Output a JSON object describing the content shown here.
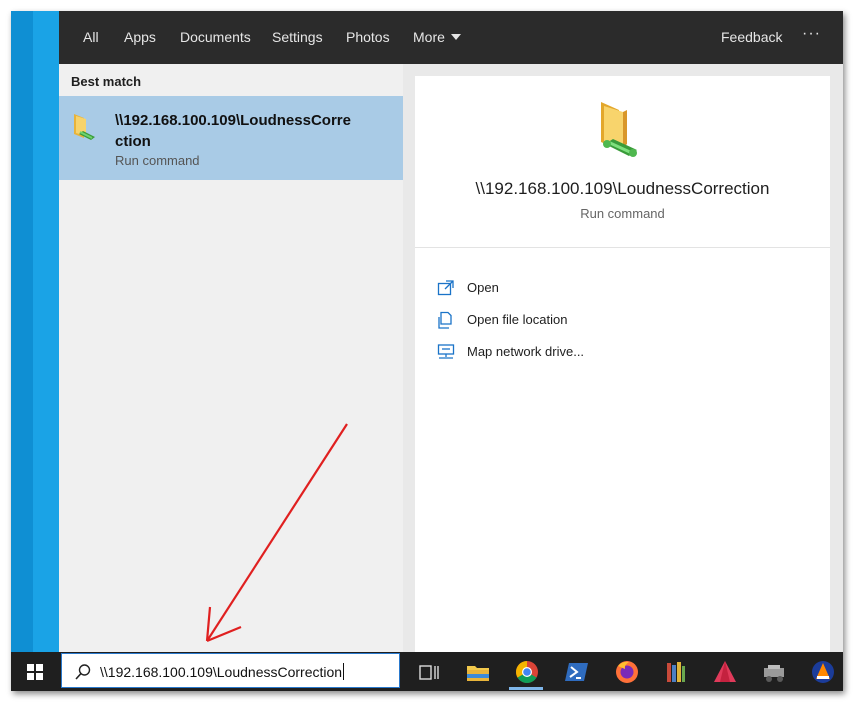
{
  "tabs": {
    "all": "All",
    "apps": "Apps",
    "documents": "Documents",
    "settings": "Settings",
    "photos": "Photos",
    "more": "More",
    "feedback": "Feedback",
    "overflow": "···"
  },
  "results": {
    "section_label": "Best match",
    "best_name": "\\\\192.168.100.109\\LoudnessCorrection",
    "best_type": "Run command"
  },
  "preview": {
    "name": "\\\\192.168.100.109\\LoudnessCorrection",
    "type": "Run command",
    "actions": [
      {
        "label": "Open",
        "icon": "open-icon"
      },
      {
        "label": "Open file location",
        "icon": "file-location-icon"
      },
      {
        "label": "Map network drive...",
        "icon": "network-drive-icon"
      }
    ]
  },
  "search": {
    "value": "\\\\192.168.100.109\\LoudnessCorrection",
    "icon": "search-icon"
  },
  "taskbar": {
    "apps": [
      "task-view-icon",
      "file-explorer-icon",
      "chrome-icon",
      "powershell-icon",
      "firefox-icon",
      "library-icon",
      "affinity-icon",
      "app-icon",
      "vlc-icon"
    ]
  },
  "colors": {
    "selected": "#a9cbe6",
    "accent": "#1a73c8",
    "topbar": "#2b2b2b",
    "taskbar": "#1f1f1f",
    "annotation": "#e02020"
  }
}
